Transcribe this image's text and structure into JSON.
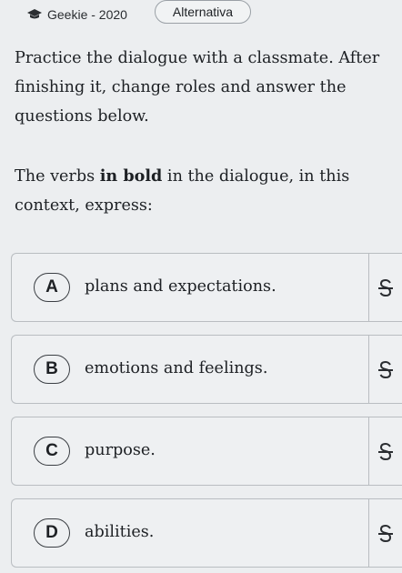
{
  "topbar": {
    "source_label": "Geekie - 2020",
    "type_label": "Alternativa"
  },
  "question": {
    "paragraph1": "Practice the dialogue with a classmate. After finishing it, change roles and answer the questions below.",
    "paragraph2_before": "The verbs ",
    "paragraph2_bold": "in bold",
    "paragraph2_after": " in the dialogue, in this context, express:"
  },
  "options": [
    {
      "letter": "A",
      "text": "plans and expectations."
    },
    {
      "letter": "B",
      "text": "emotions and feelings."
    },
    {
      "letter": "C",
      "text": "purpose."
    },
    {
      "letter": "D",
      "text": "abilities."
    }
  ],
  "icons": {
    "source": "graduation-cap-icon",
    "strike": "strikethrough-s-icon"
  }
}
